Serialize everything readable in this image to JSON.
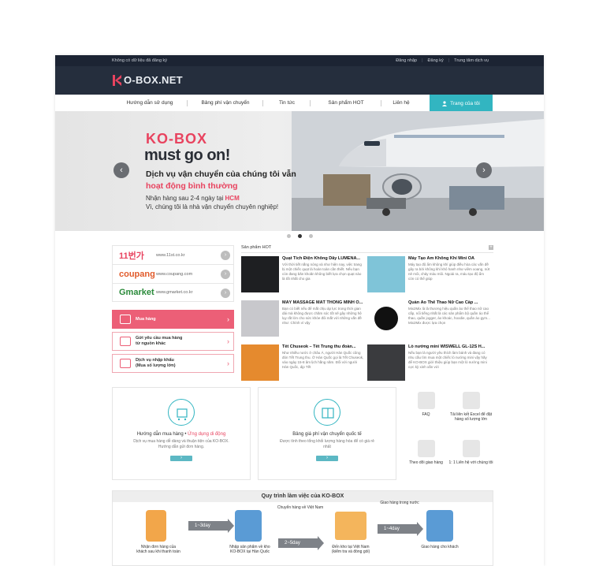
{
  "topbar": {
    "notice": "Không có dữ liệu đã đăng ký",
    "links": [
      "Đăng nhập",
      "Đăng ký",
      "Trung tâm dịch vụ"
    ]
  },
  "brand": {
    "logo_main": "K",
    "logo_text": "O-BOX.NET"
  },
  "nav": {
    "items": [
      "Hướng dẫn sử dụng",
      "Bảng phí vận chuyển",
      "Tin tức",
      "Sản phẩm HOT",
      "Liên hệ"
    ],
    "cta": "Trang của tôi"
  },
  "hero": {
    "brand": "KO-BOX",
    "slogan": "must go on!",
    "line1": "Dịch vụ vận chuyển của chúng tôi vẫn",
    "line2": "hoạt động bình thường",
    "line3_prefix": "Nhận hàng sau 2-4 ngày tại ",
    "line3_city": "HCM",
    "line4": "Vì, chúng tôi là nhà vận chuyển chuyên nghiệp!",
    "prev": "‹",
    "next": "›"
  },
  "partners": [
    {
      "name": "11번가",
      "url": "www.11st.co.kr",
      "color": "#e8435f"
    },
    {
      "name": "coupang",
      "url": "www.coupang.com",
      "color": "#e15b2b"
    },
    {
      "name": "Gmarket",
      "url": "www.gmarket.co.kr",
      "color": "#2a8a3a"
    }
  ],
  "services": {
    "buy": "Mua hàng",
    "request_line1": "Gửi yêu cầu mua hàng",
    "request_line2": "từ nguồn khác",
    "import_line1": "Dịch vụ nhập khẩu",
    "import_line2": "(Mua số lượng lớn)"
  },
  "hot": {
    "title": "Sản phẩm HOT",
    "plus": "+",
    "items": [
      {
        "title": "Quạt Tích Điện Không Dây LUMENA...",
        "desc": "Với thời tiết nắng nóng và như hiện nay, việc trang bị một chiếc quạt là hoàn toàn cần thiết. Nếu bạn còn đang băn khoăn không biết lựa chọn quạt nào là tốt nhất cho gia"
      },
      {
        "title": "Máy Tạo Ẩm Không Khí Mini OA",
        "desc": "Máy tạo độ ẩm không khí giúp điều hòa các vấn đề gây ra bởi không khí khô hanh như viêm xoang, nứt nẻ môi, chảy máu mũi. Ngoài ra, máu tạo độ ẩm còn có thể giúp"
      },
      {
        "title": "MÁY MASSAGE MẮT THÔNG MINH O...",
        "desc": "Bạn có biết nếu để mắt chịu áp lực trong thời gian dài mà không được chăm sóc tốt sẽ gây những hệ lụy rất lớn cho sức khỏe đôi mắt với những vấn đề như: Chính vì vậy"
      },
      {
        "title": "Quần Áo Thể Thao Nữ Cao Cấp ...",
        "desc": "Mix2Mix là là thương hiệu quần áo thể thao nữ cao cấp, nổi tiếng nhất là các sản phẩm bộ quần áo thể thao, quần jogger, áo khoác, hoodie, quần áo gym... Mix2Mix được lựa chọn"
      },
      {
        "title": "Tết Chuseok – Tết Trung thu đoàn...",
        "desc": "Như nhiều nước ở châu Á, người Hàn Quốc cũng đón Tết Trung thu. Ở Hàn Quốc gọi là Tết Chuseok, vào ngày 15-8 âm lịch hằng năm. Đối với người Hàn Quốc, dịp Tết"
      },
      {
        "title": "Lò nướng mini WISWELL GL-12S H...",
        "desc": "Nếu bạn là người yêu thích làm bánh và đang có nhu cầu tìm mua một chiếc lò nướng mini vậy hãy để KO-BOX giới thiệu giúp bạn một lò nướng mini cực kỳ xinh xắn với"
      }
    ]
  },
  "cards": {
    "guide_title": "Hướng dẫn mua hàng • ",
    "guide_link": "Ứng dụng di động",
    "guide_desc": "Dịch vụ mua hàng dễ dàng và thuận tiện của KO-BOX. Hướng dẫn gửi đơn hàng.",
    "fee_title": "Bảng giá phí vận chuyển quốc tế",
    "fee_desc": "Được tính theo tổng khối lượng hàng hóa để có giá rẻ nhất",
    "btn": "›"
  },
  "mini": {
    "faq": "FAQ",
    "download": "Tải liên kết Excel để đặt hàng số lượng lớn",
    "track": "Theo dõi giao hàng",
    "contact": "1: 1 Liên hệ với chúng tôi"
  },
  "process": {
    "title": "Quy trình làm việc của KO-BOX",
    "step1": "Nhận đơn hàng của khách sau khi thanh toán",
    "step2": "Nhập sản phẩm về kho KO-BOX tại Hàn Quốc",
    "step3": "Đến kho tại Việt Nam (kiểm tra và đóng gói)",
    "step4": "Giao hàng cho khách",
    "arrow1": "1~3day",
    "arrow2": "2~5day",
    "arrow3": "1~4day",
    "label_ship_vn": "Chuyển hàng về Việt Nam",
    "label_domestic": "Giao hàng trong nước"
  },
  "colors": {
    "accent": "#32b5c1",
    "pink": "#ec5f77",
    "dark": "#252e3d"
  }
}
